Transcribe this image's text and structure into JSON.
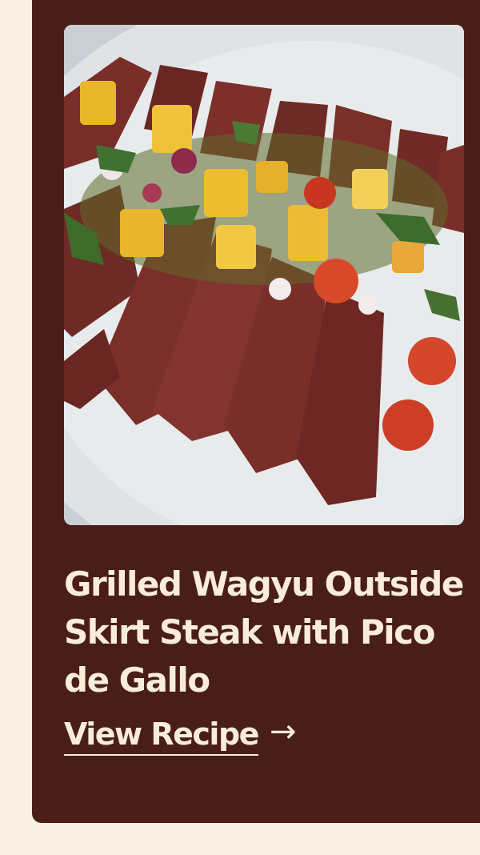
{
  "recipe": {
    "title": "Grilled Wagyu Outside Skirt Steak with Pico de Gallo",
    "cta_label": "View Recipe",
    "cta_arrow": "→",
    "image_subject": "sliced-steak-with-pico-de-gallo"
  },
  "colors": {
    "page_background": "#f9f0e3",
    "card_background": "#4a1e18",
    "text": "#f9ecdb"
  }
}
